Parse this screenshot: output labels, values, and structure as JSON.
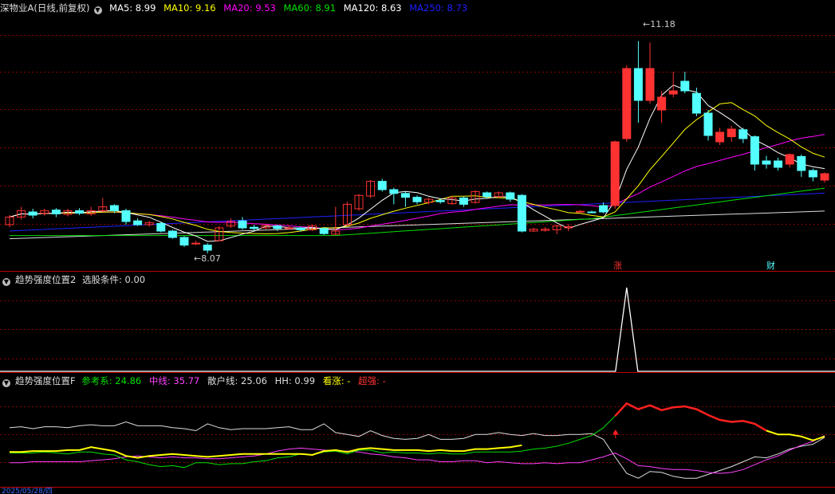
{
  "colors": {
    "bg": "#000000",
    "grid": "#8b0000",
    "up": "#ff3232",
    "down": "#54ffff",
    "ma5": "#ffffff",
    "ma10": "#ffff00",
    "ma20": "#ff00ff",
    "ma60": "#00e000",
    "ma120": "#ffffff",
    "ma250": "#2020ff"
  },
  "main": {
    "title": "深物业A(日线,前复权)",
    "ma_values": [
      {
        "label": "MA5: 8.99",
        "color": "#ffffff"
      },
      {
        "label": "MA10: 9.16",
        "color": "#ffff00"
      },
      {
        "label": "MA20: 9.53",
        "color": "#ff00ff"
      },
      {
        "label": "MA60: 8.91",
        "color": "#00e000"
      },
      {
        "label": "MA120: 8.63",
        "color": "#ffffff"
      },
      {
        "label": "MA250: 8.73",
        "color": "#2020ff"
      }
    ],
    "high_label": "11.18",
    "low_label": "8.07",
    "flags": [
      {
        "text": "涨",
        "color": "#ff3232"
      },
      {
        "text": "财",
        "color": "#54ffff"
      }
    ]
  },
  "panel2": {
    "title": "趋势强度位置2",
    "items": [
      {
        "label": "选股条件: 0.00",
        "color": "#dddddd"
      }
    ]
  },
  "panel3": {
    "title": "趋势强度位置F",
    "items": [
      {
        "label": "参考系: 24.86",
        "color": "#00e000"
      },
      {
        "label": "中线: 35.77",
        "color": "#ff40ff"
      },
      {
        "label": "散户线: 25.06",
        "color": "#dddddd"
      },
      {
        "label": "HH: 0.99",
        "color": "#dddddd"
      },
      {
        "label": "看涨: -",
        "color": "#ffff00"
      },
      {
        "label": "超强: -",
        "color": "#ff3232"
      }
    ]
  },
  "date_label": "2025/05/28/四",
  "chart_data": {
    "type": "candlestick",
    "price_range": [
      7.6,
      11.6
    ],
    "candles": [
      [
        8.3,
        8.42,
        8.45,
        8.26
      ],
      [
        8.42,
        8.52,
        8.58,
        8.38
      ],
      [
        8.5,
        8.45,
        8.55,
        8.4
      ],
      [
        8.48,
        8.52,
        8.55,
        8.44
      ],
      [
        8.53,
        8.47,
        8.56,
        8.42
      ],
      [
        8.46,
        8.52,
        8.55,
        8.43
      ],
      [
        8.52,
        8.48,
        8.56,
        8.45
      ],
      [
        8.47,
        8.52,
        8.58,
        8.44
      ],
      [
        8.52,
        8.58,
        8.72,
        8.5
      ],
      [
        8.6,
        8.52,
        8.62,
        8.48
      ],
      [
        8.52,
        8.35,
        8.55,
        8.3
      ],
      [
        8.36,
        8.3,
        8.4,
        8.28
      ],
      [
        8.3,
        8.33,
        8.36,
        8.27
      ],
      [
        8.32,
        8.2,
        8.34,
        8.18
      ],
      [
        8.2,
        8.1,
        8.22,
        8.08
      ],
      [
        8.1,
        7.98,
        8.12,
        7.95
      ],
      [
        8.0,
        8.01,
        8.05,
        7.98
      ],
      [
        7.98,
        7.9,
        8.01,
        7.85
      ],
      [
        8.05,
        8.25,
        8.28,
        8.04
      ],
      [
        8.28,
        8.35,
        8.4,
        8.25
      ],
      [
        8.36,
        8.25,
        8.42,
        8.22
      ],
      [
        8.26,
        8.24,
        8.3,
        8.21
      ],
      [
        8.25,
        8.29,
        8.31,
        8.23
      ],
      [
        8.28,
        8.24,
        8.3,
        8.2
      ],
      [
        8.25,
        8.25,
        8.29,
        8.22
      ],
      [
        8.25,
        8.22,
        8.27,
        8.19
      ],
      [
        8.22,
        8.28,
        8.3,
        8.2
      ],
      [
        8.24,
        8.16,
        8.26,
        8.14
      ],
      [
        8.15,
        8.2,
        8.58,
        8.14
      ],
      [
        8.3,
        8.62,
        8.66,
        8.28
      ],
      [
        8.55,
        8.76,
        8.78,
        8.52
      ],
      [
        8.75,
        8.98,
        9.0,
        8.72
      ],
      [
        8.98,
        8.85,
        9.02,
        8.82
      ],
      [
        8.85,
        8.79,
        8.88,
        8.62
      ],
      [
        8.79,
        8.73,
        8.82,
        8.58
      ],
      [
        8.73,
        8.66,
        8.76,
        8.62
      ],
      [
        8.65,
        8.7,
        8.72,
        8.62
      ],
      [
        8.68,
        8.66,
        8.71,
        8.63
      ],
      [
        8.63,
        8.72,
        8.75,
        8.61
      ],
      [
        8.72,
        8.62,
        8.74,
        8.58
      ],
      [
        8.65,
        8.82,
        8.84,
        8.63
      ],
      [
        8.8,
        8.74,
        8.82,
        8.71
      ],
      [
        8.74,
        8.8,
        8.82,
        8.72
      ],
      [
        8.8,
        8.7,
        8.82,
        8.66
      ],
      [
        8.76,
        8.2,
        8.78,
        8.18
      ],
      [
        8.2,
        8.23,
        8.25,
        8.19
      ],
      [
        8.21,
        8.23,
        8.26,
        8.19
      ],
      [
        8.22,
        8.28,
        8.3,
        8.15
      ],
      [
        8.25,
        8.27,
        8.31,
        8.2
      ],
      [
        8.5,
        8.51,
        8.53,
        8.49
      ],
      [
        8.5,
        8.49,
        8.52,
        8.48
      ],
      [
        8.6,
        8.5,
        8.65,
        8.48
      ],
      [
        8.6,
        9.6,
        9.62,
        8.55
      ],
      [
        9.65,
        10.75,
        10.8,
        9.6
      ],
      [
        10.75,
        10.25,
        11.18,
        9.9
      ],
      [
        10.25,
        10.75,
        11.16,
        10.2
      ],
      [
        10.1,
        10.3,
        10.4,
        9.9
      ],
      [
        10.35,
        10.4,
        10.7,
        10.3
      ],
      [
        10.55,
        10.4,
        10.7,
        10.36
      ],
      [
        10.36,
        10.05,
        10.45,
        10.0
      ],
      [
        10.05,
        9.7,
        10.1,
        9.62
      ],
      [
        9.6,
        9.75,
        9.82,
        9.55
      ],
      [
        9.68,
        9.8,
        9.85,
        9.6
      ],
      [
        9.79,
        9.65,
        9.82,
        9.58
      ],
      [
        9.68,
        9.25,
        9.7,
        9.15
      ],
      [
        9.3,
        9.25,
        9.38,
        9.18
      ],
      [
        9.3,
        9.2,
        9.35,
        9.15
      ],
      [
        9.25,
        9.4,
        9.42,
        9.2
      ],
      [
        9.37,
        9.15,
        9.4,
        9.05
      ],
      [
        9.15,
        9.05,
        9.18,
        8.98
      ],
      [
        9.0,
        9.1,
        9.12,
        8.96
      ]
    ]
  }
}
